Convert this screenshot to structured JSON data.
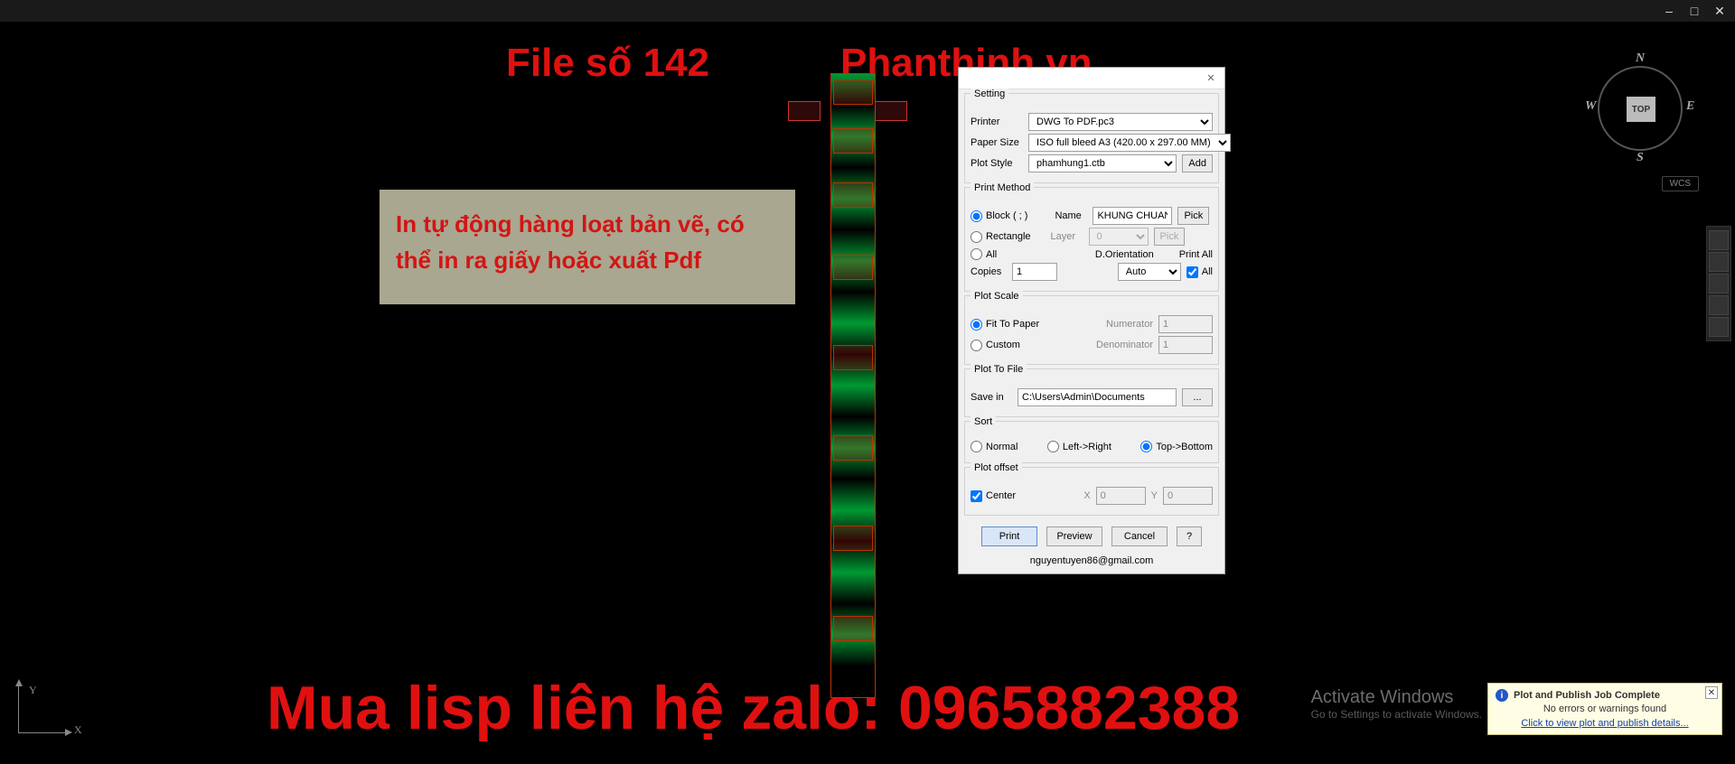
{
  "titlebar": {
    "minimize": "–",
    "maximize": "□",
    "close": "✕"
  },
  "watermarks": {
    "file_label": "File số 142",
    "site": "Phanthinh.vn",
    "contact": "Mua lisp liên hệ zalo: 0965882388"
  },
  "info_box": "In tự động hàng loạt bản vẽ, có thể in ra giấy hoặc xuất Pdf",
  "dialog": {
    "setting": {
      "title": "Setting",
      "printer_label": "Printer",
      "printer_value": "DWG To PDF.pc3",
      "paper_label": "Paper Size",
      "paper_value": "ISO full bleed A3 (420.00 x 297.00 MM)",
      "plotstyle_label": "Plot Style",
      "plotstyle_value": "phamhung1.ctb",
      "add_btn": "Add"
    },
    "print_method": {
      "title": "Print Method",
      "block_label": "Block ( ; )",
      "rectangle_label": "Rectangle",
      "all_label": "All",
      "name_label": "Name",
      "name_value": "KHUNG CHUAN",
      "pick_btn": "Pick",
      "layer_label": "Layer",
      "layer_value": "0",
      "copies_label": "Copies",
      "copies_value": "1",
      "orientation_label": "D.Orientation",
      "orientation_value": "Auto",
      "print_all_label": "Print All",
      "all_check_label": "All",
      "selected": "block"
    },
    "plot_scale": {
      "title": "Plot Scale",
      "fit_label": "Fit To Paper",
      "custom_label": "Custom",
      "numerator_label": "Numerator",
      "numerator_value": "1",
      "denominator_label": "Denominator",
      "denominator_value": "1",
      "selected": "fit"
    },
    "plot_to_file": {
      "title": "Plot To File",
      "save_label": "Save in",
      "save_value": "C:\\Users\\Admin\\Documents",
      "browse_btn": "..."
    },
    "sort": {
      "title": "Sort",
      "normal": "Normal",
      "lr": "Left->Right",
      "tb": "Top->Bottom",
      "selected": "tb"
    },
    "plot_offset": {
      "title": "Plot offset",
      "center_label": "Center",
      "x_label": "X",
      "x_value": "0",
      "y_label": "Y",
      "y_value": "0",
      "center_checked": true
    },
    "buttons": {
      "print": "Print",
      "preview": "Preview",
      "cancel": "Cancel",
      "help": "?"
    },
    "footer": "nguyentuyen86@gmail.com"
  },
  "viewcube": {
    "face": "TOP",
    "n": "N",
    "s": "S",
    "e": "E",
    "w": "W",
    "wcs": "WCS"
  },
  "ucs": {
    "x": "X",
    "y": "Y"
  },
  "activate": {
    "line1": "Activate Windows",
    "line2": "Go to Settings to activate Windows."
  },
  "notification": {
    "title": "Plot and Publish Job Complete",
    "body": "No errors or warnings found",
    "link": "Click to view plot and publish details...",
    "close": "✕"
  }
}
